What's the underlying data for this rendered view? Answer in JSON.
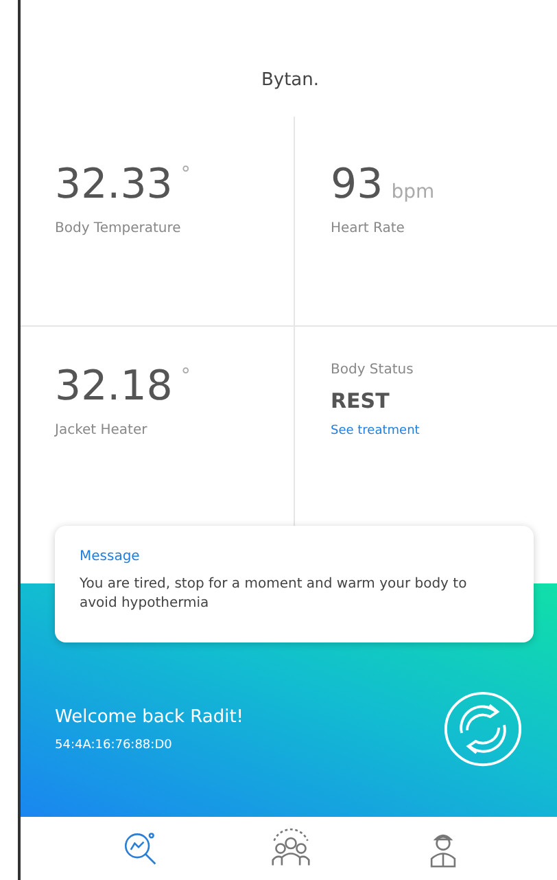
{
  "app": {
    "title": "Bytan."
  },
  "metrics": [
    {
      "kind": "value",
      "value": "32.33",
      "unit": "°",
      "label": "Body Temperature"
    },
    {
      "kind": "value",
      "value": "93",
      "unit": "bpm",
      "label": "Heart Rate"
    },
    {
      "kind": "value",
      "value": "32.18",
      "unit": "°",
      "label": "Jacket Heater"
    },
    {
      "kind": "status",
      "label": "Body Status",
      "value": "REST",
      "link": "See treatment"
    }
  ],
  "message": {
    "title": "Message",
    "text": "You are tired, stop for a moment and warm your body to avoid hypothermia"
  },
  "banner": {
    "greeting": "Welcome back Radit!",
    "device_id": "54:4A:16:76:88:D0"
  },
  "tabs": [
    {
      "kind": "search",
      "selected": true
    },
    {
      "kind": "group",
      "selected": false
    },
    {
      "kind": "person",
      "selected": false
    }
  ]
}
